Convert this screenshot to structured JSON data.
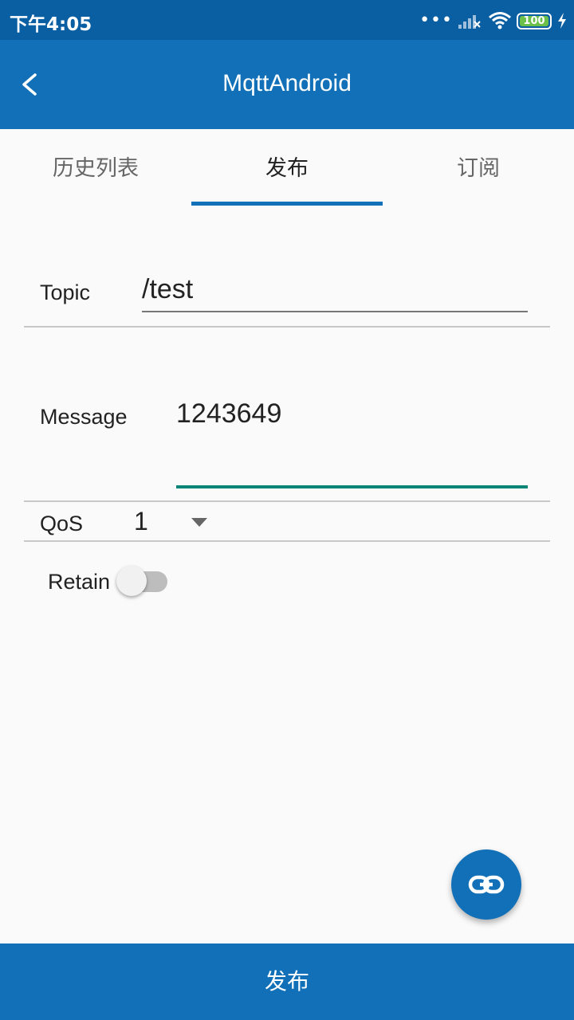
{
  "status_bar": {
    "time": "下午4:05",
    "battery_level": "100",
    "icons": [
      "dots-icon",
      "signal-icon",
      "wifi-icon",
      "battery-icon",
      "charging-icon"
    ]
  },
  "app_bar": {
    "title": "MqttAndroid",
    "back_icon": "back-arrow-icon"
  },
  "tabs": [
    {
      "label": "历史列表",
      "active": false
    },
    {
      "label": "发布",
      "active": true
    },
    {
      "label": "订阅",
      "active": false
    }
  ],
  "form": {
    "topic_label": "Topic",
    "topic_value": "/test",
    "message_label": "Message",
    "message_value": "1243649",
    "qos_label": "QoS",
    "qos_value": "1",
    "retain_label": "Retain",
    "retain_on": false
  },
  "fab": {
    "icon": "link-icon"
  },
  "publish_button": {
    "label": "发布"
  },
  "colors": {
    "primary": "#1170b7",
    "status_bar": "#0a5fa3",
    "accent": "#0a8577",
    "background": "#fafafa"
  }
}
